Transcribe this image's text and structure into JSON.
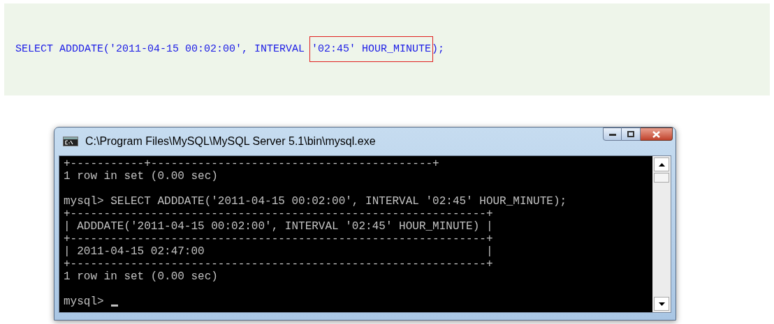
{
  "code_block": {
    "before": "SELECT ADDDATE('2011-04-15 00:02:00', INTERVAL ",
    "highlight": "'02:45' HOUR_MINUTE",
    "after": ");"
  },
  "console_window": {
    "title": "C:\\Program Files\\MySQL\\MySQL Server 5.1\\bin\\mysql.exe",
    "output_blocks": [
      {
        "lines": [
          "+-----------+------------------------------------------+",
          "1 row in set (0.00 sec)"
        ]
      },
      {
        "lines": [
          "mysql> SELECT ADDDATE('2011-04-15 00:02:00', INTERVAL '02:45' HOUR_MINUTE);",
          "+--------------------------------------------------------------+",
          "| ADDDATE('2011-04-15 00:02:00', INTERVAL '02:45' HOUR_MINUTE) |",
          "+--------------------------------------------------------------+",
          "| 2011-04-15 02:47:00                                          |",
          "+--------------------------------------------------------------+",
          "1 row in set (0.00 sec)"
        ]
      }
    ],
    "prompt": "mysql>"
  }
}
